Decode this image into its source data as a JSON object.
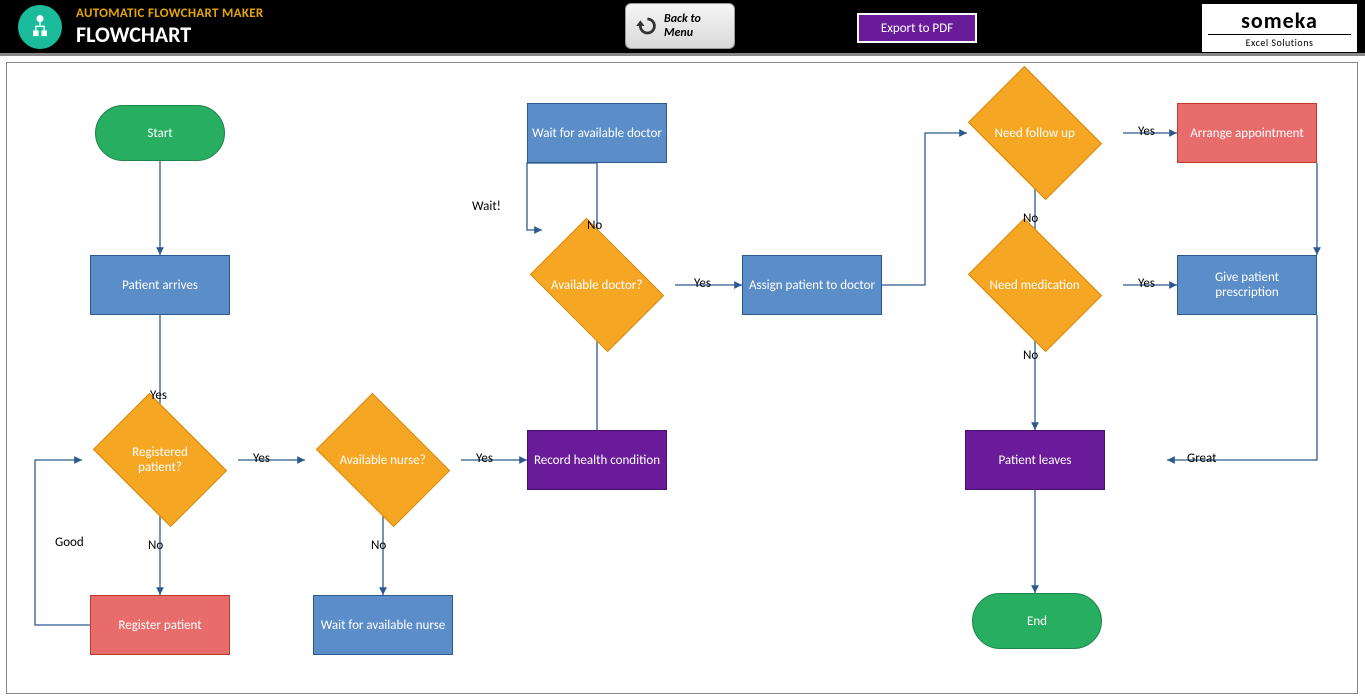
{
  "header": {
    "title_small": "AUTOMATIC FLOWCHART MAKER",
    "title_big": "FLOWCHART",
    "back_label": "Back to Menu",
    "export_label": "Export to PDF",
    "brand_main": "someka",
    "brand_sub": "Excel Solutions"
  },
  "nodes": {
    "start": "Start",
    "patient_arrives": "Patient arrives",
    "registered_patient": "Registered patient?",
    "register_patient": "Register patient",
    "available_nurse": "Available nurse?",
    "wait_nurse": "Wait for available nurse",
    "record_health": "Record health condition",
    "available_doctor": "Available doctor?",
    "wait_doctor": "Wait for available doctor",
    "assign_patient": "Assign patient to doctor",
    "need_followup": "Need follow up",
    "arrange_appointment": "Arrange appointment",
    "need_medication": "Need medication",
    "give_prescription": "Give patient prescription",
    "patient_leaves": "Patient leaves",
    "end": "End"
  },
  "labels": {
    "yes": "Yes",
    "no": "No",
    "wait": "Wait!",
    "good": "Good",
    "great": "Great"
  }
}
